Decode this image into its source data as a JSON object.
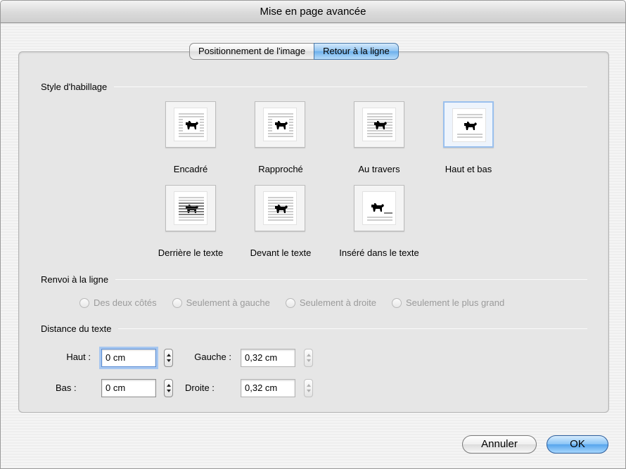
{
  "window": {
    "title": "Mise en page avancée"
  },
  "tabs": [
    {
      "label": "Positionnement de l'image",
      "active": false
    },
    {
      "label": "Retour à la ligne",
      "active": true
    }
  ],
  "wrap_style": {
    "header": "Style d'habillage",
    "options": [
      {
        "label": "Encadré",
        "icon": "wrap-square-icon",
        "selected": false
      },
      {
        "label": "Rapproché",
        "icon": "wrap-tight-icon",
        "selected": false
      },
      {
        "label": "Au travers",
        "icon": "wrap-through-icon",
        "selected": false
      },
      {
        "label": "Haut et bas",
        "icon": "wrap-top-bottom-icon",
        "selected": true
      },
      {
        "label": "Derrière le texte",
        "icon": "wrap-behind-text-icon",
        "selected": false
      },
      {
        "label": "Devant le texte",
        "icon": "wrap-in-front-of-text-icon",
        "selected": false
      },
      {
        "label": "Inséré dans le texte",
        "icon": "wrap-inline-icon",
        "selected": false
      }
    ]
  },
  "wrap_text": {
    "header": "Renvoi à la ligne",
    "options": [
      {
        "label": "Des deux côtés"
      },
      {
        "label": "Seulement à gauche"
      },
      {
        "label": "Seulement à droite"
      },
      {
        "label": "Seulement le plus grand"
      }
    ]
  },
  "distance": {
    "header": "Distance du texte",
    "top_label": "Haut :",
    "top_value": "0 cm",
    "bottom_label": "Bas :",
    "bottom_value": "0 cm",
    "left_label": "Gauche :",
    "left_value": "0,32 cm",
    "right_label": "Droite :",
    "right_value": "0,32 cm"
  },
  "buttons": {
    "cancel": "Annuler",
    "ok": "OK"
  },
  "colors": {
    "accent": "#6cb0ec",
    "selected_border": "#9ac0ee",
    "disabled_text": "#9b9b9b"
  }
}
